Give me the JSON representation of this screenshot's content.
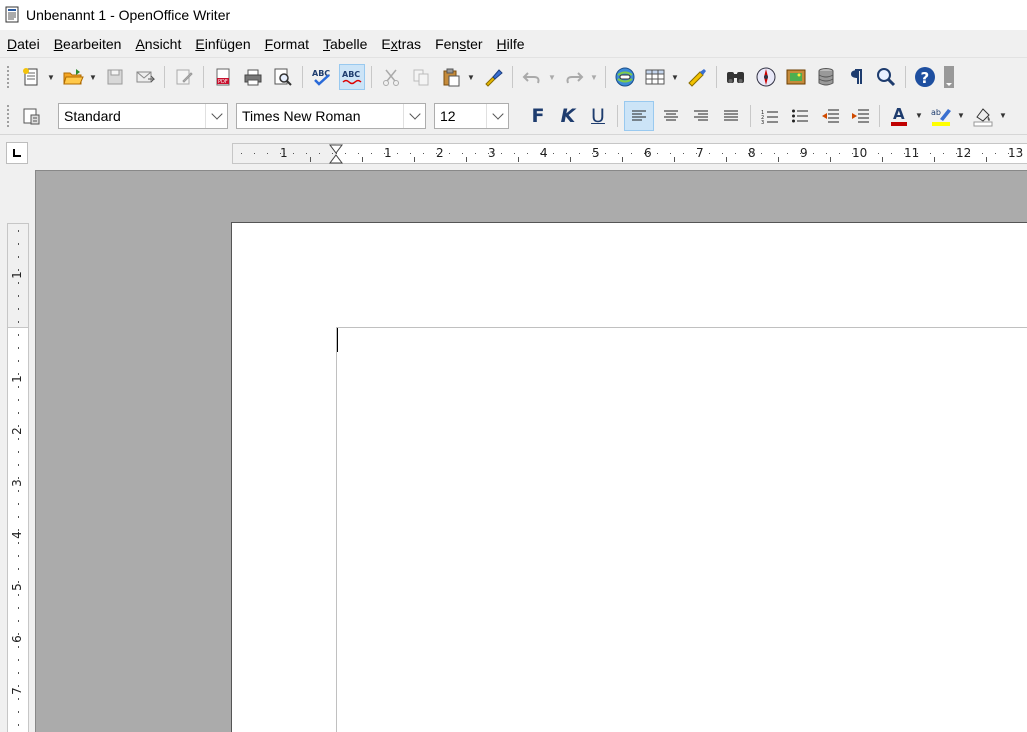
{
  "window": {
    "title": "Unbenannt 1 - OpenOffice Writer"
  },
  "menubar": {
    "items": [
      {
        "acc": "D",
        "rest": "atei"
      },
      {
        "acc": "B",
        "rest": "earbeiten"
      },
      {
        "acc": "A",
        "rest": "nsicht"
      },
      {
        "acc": "E",
        "rest": "infügen"
      },
      {
        "acc": "F",
        "rest": "ormat"
      },
      {
        "acc": "T",
        "rest": "abelle"
      },
      {
        "pre": "E",
        "acc": "x",
        "rest": "tras"
      },
      {
        "pre": "Fen",
        "acc": "s",
        "rest": "ter"
      },
      {
        "acc": "H",
        "rest": "ilfe"
      }
    ]
  },
  "formatting": {
    "paragraph_style": "Standard",
    "font_name": "Times New Roman",
    "font_size": "12",
    "bold_label": "F",
    "italic_label": "K",
    "underline_label": "U"
  },
  "spellcheck": {
    "label_top": "ABC",
    "label_auto": "ABC"
  },
  "hruler": {
    "labels": [
      "1",
      "1",
      "2",
      "3",
      "4",
      "5",
      "6",
      "7",
      "8",
      "9",
      "10",
      "11",
      "12",
      "13"
    ]
  },
  "vruler": {
    "labels": [
      "1",
      "1",
      "2",
      "3",
      "4",
      "5",
      "6",
      "7"
    ]
  },
  "colors": {
    "accent": "#cce4f7",
    "doc_bg": "#ababab",
    "font_color": "#c00000",
    "highlight": "#ffff00"
  }
}
